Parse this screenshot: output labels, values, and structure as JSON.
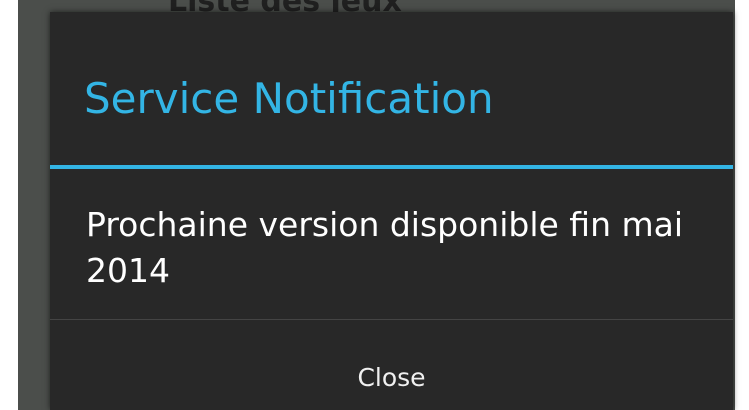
{
  "background": {
    "partial_text": "Liste des jeux"
  },
  "dialog": {
    "title": "Service Notification",
    "message": "Prochaine version disponible fin mai 2014",
    "close_label": "Close"
  },
  "colors": {
    "accent": "#33b5e5",
    "dialog_background": "#282828",
    "backdrop": "#4b4e4b"
  }
}
